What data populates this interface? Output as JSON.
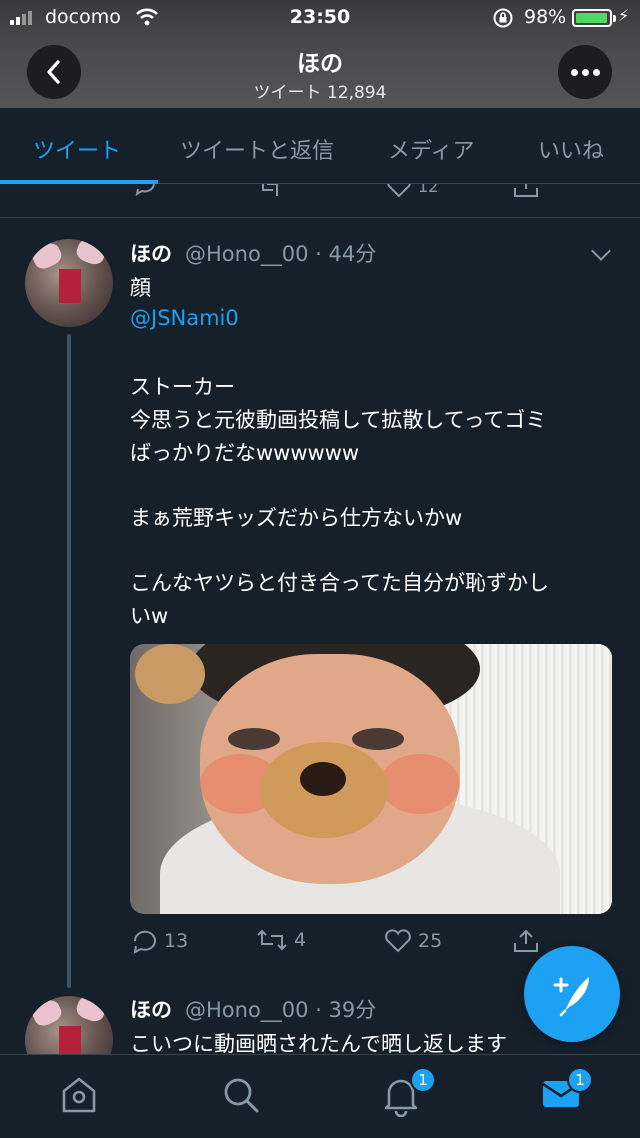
{
  "status_bar": {
    "carrier": "docomo",
    "time": "23:50",
    "battery": "98%",
    "battery_level": 0.98
  },
  "header": {
    "name": "ほの",
    "tweet_count": "ツイート 12,894"
  },
  "tabs": [
    {
      "label": "ツイート",
      "active": true
    },
    {
      "label": "ツイートと返信",
      "active": false
    },
    {
      "label": "メディア",
      "active": false
    },
    {
      "label": "いいね",
      "active": false
    }
  ],
  "previous_tweet": {
    "like_count": "12"
  },
  "tweet": {
    "name": "ほの",
    "meta": "@Hono__00 · 44分",
    "lines": [
      "顔",
      "@JSNami0",
      "ストーカー",
      "今思うと元彼動画投稿して拡散してってゴミ",
      "ばっかりだなwwwwww",
      "まぁ荒野キッズだから仕方ないかw",
      "こんなヤツらと付き合ってた自分が恥ずかし",
      "いw"
    ],
    "reply_count": "13",
    "retweet_count": "4",
    "like_count": "25"
  },
  "next_tweet": {
    "name": "ほの",
    "meta": "@Hono__00 · 39分",
    "text": "こいつに動画晒されたんで晒し返します"
  },
  "bottom_nav": {
    "notifications_badge": "1",
    "messages_badge": "1"
  },
  "colors": {
    "background": "#15202b",
    "accent": "#1da1f2",
    "secondary_text": "#8899a6",
    "divider": "#38444d"
  }
}
